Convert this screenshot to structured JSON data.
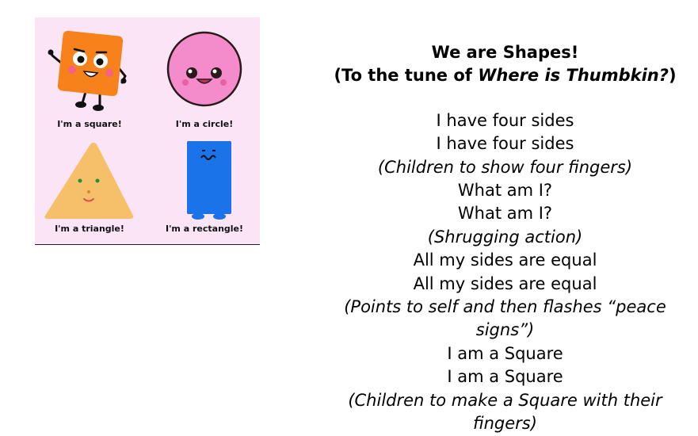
{
  "illustration": {
    "captions": {
      "square": "I'm a square!",
      "circle": "I'm a circle!",
      "triangle": "I'm a triangle!",
      "rectangle": "I'm a rectangle!"
    }
  },
  "song": {
    "title": "We are Shapes!",
    "subtitle_prefix": "(To the tune of ",
    "subtitle_tune": "Where is Thumbkin?",
    "subtitle_suffix": ")",
    "lines": [
      {
        "text": "I have four sides",
        "italic": false
      },
      {
        "text": "I have four sides",
        "italic": false
      },
      {
        "text": "(Children to show four fingers)",
        "italic": true
      },
      {
        "text": "What am I?",
        "italic": false
      },
      {
        "text": "What am I?",
        "italic": false
      },
      {
        "text": "(Shrugging action)",
        "italic": true
      },
      {
        "text": "All my sides are equal",
        "italic": false
      },
      {
        "text": "All my sides are equal",
        "italic": false
      },
      {
        "text": "(Points to self and then flashes “peace signs”)",
        "italic": true
      },
      {
        "text": "I am a Square",
        "italic": false
      },
      {
        "text": "I am a Square",
        "italic": false
      },
      {
        "text": "(Children to make a Square with their fingers)",
        "italic": true
      }
    ]
  },
  "colors": {
    "panel_bg": "#fbe4f6",
    "square": "#f7821b",
    "circle": "#f48ccb",
    "triangle": "#f6c06a",
    "rectangle": "#1a73e8"
  }
}
